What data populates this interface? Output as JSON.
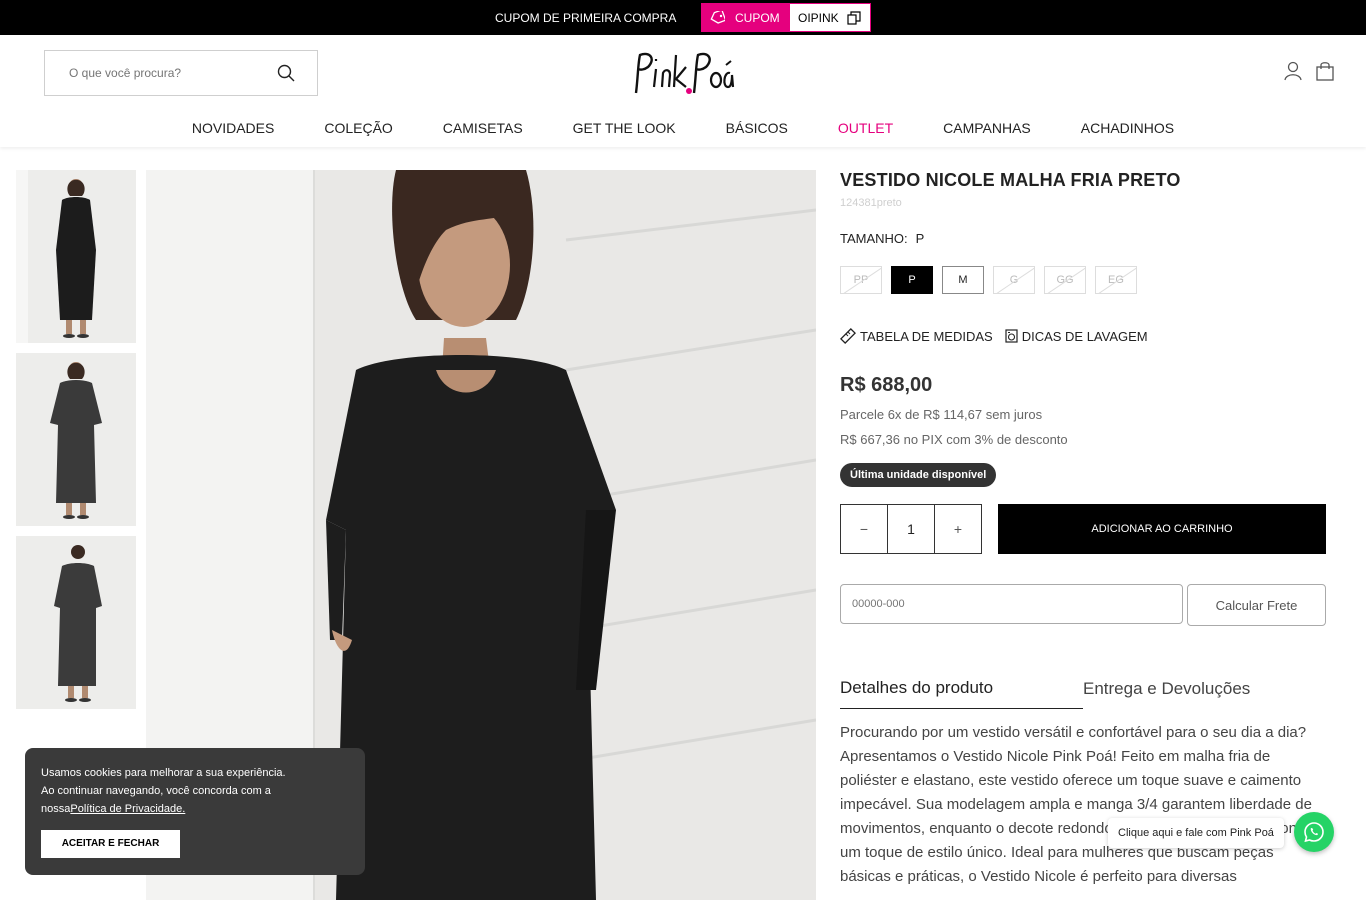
{
  "topbar": {
    "promo_text": "CUPOM DE PRIMEIRA COMPRA",
    "coupon_label": "CUPOM",
    "coupon_code": "OIPINK",
    "accent_color": "#e5007e"
  },
  "header": {
    "search_placeholder": "O que você procura?",
    "logo_text": "PinkPoá",
    "icons": [
      "search-icon",
      "user-icon",
      "bag-icon"
    ]
  },
  "nav": {
    "items": [
      "NOVIDADES",
      "COLEÇÃO",
      "CAMISETAS",
      "GET THE LOOK",
      "BÁSICOS",
      "OUTLET",
      "CAMPANHAS",
      "ACHADINHOS"
    ]
  },
  "product": {
    "title": "VESTIDO NICOLE MALHA FRIA PRETO",
    "sku": "124381preto",
    "size_label": "TAMANHO:",
    "selected_size": "P",
    "sizes": [
      "PP",
      "P",
      "M",
      "G",
      "GG",
      "EG"
    ],
    "size_chart_label": "TABELA DE MEDIDAS",
    "wash_tips_label": "DICAS DE LAVAGEM",
    "price": "R$ 688,00",
    "installments": "Parcele  6x de R$ 114,67 sem juros",
    "pix": "R$ 667,36 no PIX com 3% de desconto",
    "stock_badge": "Última unidade disponível",
    "quantity": "1",
    "qty_minus": "−",
    "qty_plus": "+",
    "add_to_cart": "ADICIONAR AO CARRINHO",
    "cep_placeholder": "00000-000",
    "calc_shipping": "Calcular Frete",
    "tab_details": "Detalhes do produto",
    "tab_delivery": "Entrega e Devoluções",
    "description": "Procurando por um vestido versátil e confortável para o seu dia a dia? Apresentamos o Vestido Nicole Pink Poá! Feito em malha fria de poliéster e elastano, este vestido oferece um toque suave e caimento impecável. Sua modelagem ampla e manga 3/4 garantem liberdade de movimentos, enquanto o decote redondo e os bolsos laterais adicionam um toque de estilo único. Ideal para mulheres que buscam peças básicas e práticas, o Vestido Nicole é perfeito para diversas"
  },
  "cookie": {
    "line1": "Usamos cookies para melhorar a sua experiência.",
    "line2": "Ao continuar navegando, você concorda com a",
    "line3_prefix": "nossa",
    "policy_link": "Política de Privacidade.",
    "accept": "ACEITAR E FECHAR"
  },
  "whatsapp": {
    "bubble": "Clique aqui e fale com Pink Poá",
    "color": "#25d366"
  }
}
